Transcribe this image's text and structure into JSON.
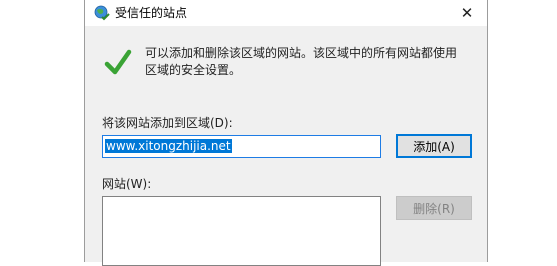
{
  "dialog": {
    "title": "受信任的站点",
    "close_label": "✕",
    "info_text": "可以添加和删除该区域的网站。该区域中的所有网站都使用区域的安全设置。",
    "add_site_label": "将该网站添加到区域(D):",
    "url_value": "www.xitongzhijia.net",
    "add_button_label": "添加(A)",
    "sites_label": "网站(W):",
    "sites": [],
    "remove_button_label": "删除(R)"
  },
  "colors": {
    "accent": "#0078d7",
    "check": "#3aa335",
    "dialog_bg": "#f0f0f0"
  },
  "icons": {
    "title": "globe-check-icon",
    "status": "green-checkmark-icon"
  }
}
